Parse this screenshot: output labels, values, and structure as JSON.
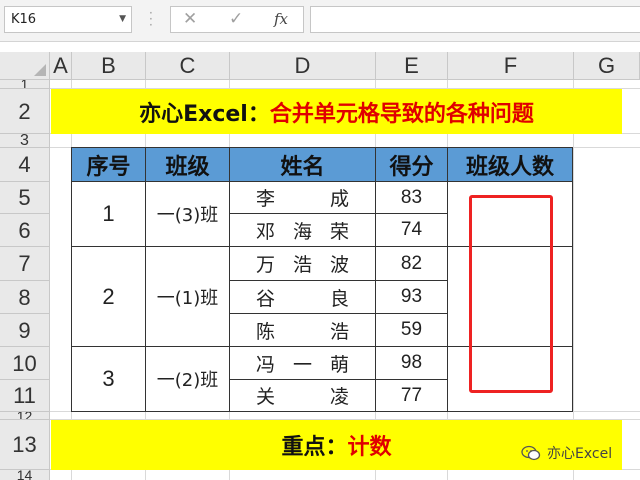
{
  "name_box": "K16",
  "formula_bar": {
    "cancel_icon": "✕",
    "confirm_icon": "✓",
    "fx_label": "fx",
    "value": ""
  },
  "columns": [
    "A",
    "B",
    "C",
    "D",
    "E",
    "F",
    "G"
  ],
  "rows": [
    "1",
    "2",
    "3",
    "4",
    "5",
    "6",
    "7",
    "8",
    "9",
    "10",
    "11",
    "12",
    "13",
    "14"
  ],
  "title_banner": {
    "black": "亦心Excel：",
    "red": "合并单元格导致的各种问题"
  },
  "table": {
    "headers": [
      "序号",
      "班级",
      "姓名",
      "得分",
      "班级人数"
    ],
    "groups": [
      {
        "index": "1",
        "class": "一(3)班",
        "members": [
          {
            "name": [
              "李",
              "成"
            ],
            "score": "83"
          },
          {
            "name": [
              "邓",
              "海",
              "荣"
            ],
            "score": "74"
          }
        ]
      },
      {
        "index": "2",
        "class": "一(1)班",
        "members": [
          {
            "name": [
              "万",
              "浩",
              "波"
            ],
            "score": "82"
          },
          {
            "name": [
              "谷",
              "良"
            ],
            "score": "93"
          },
          {
            "name": [
              "陈",
              "浩"
            ],
            "score": "59"
          }
        ]
      },
      {
        "index": "3",
        "class": "一(2)班",
        "members": [
          {
            "name": [
              "冯",
              "一",
              "萌"
            ],
            "score": "98"
          },
          {
            "name": [
              "关",
              "凌"
            ],
            "score": "77"
          }
        ]
      }
    ]
  },
  "bottom_banner": {
    "black": "重点：",
    "red": "计数"
  },
  "watermark": "亦心Excel",
  "colors": {
    "banner_yellow": "#ffff00",
    "header_blue": "#5b9bd5",
    "accent_red": "#e00000",
    "highlight_box": "#ee2222"
  }
}
